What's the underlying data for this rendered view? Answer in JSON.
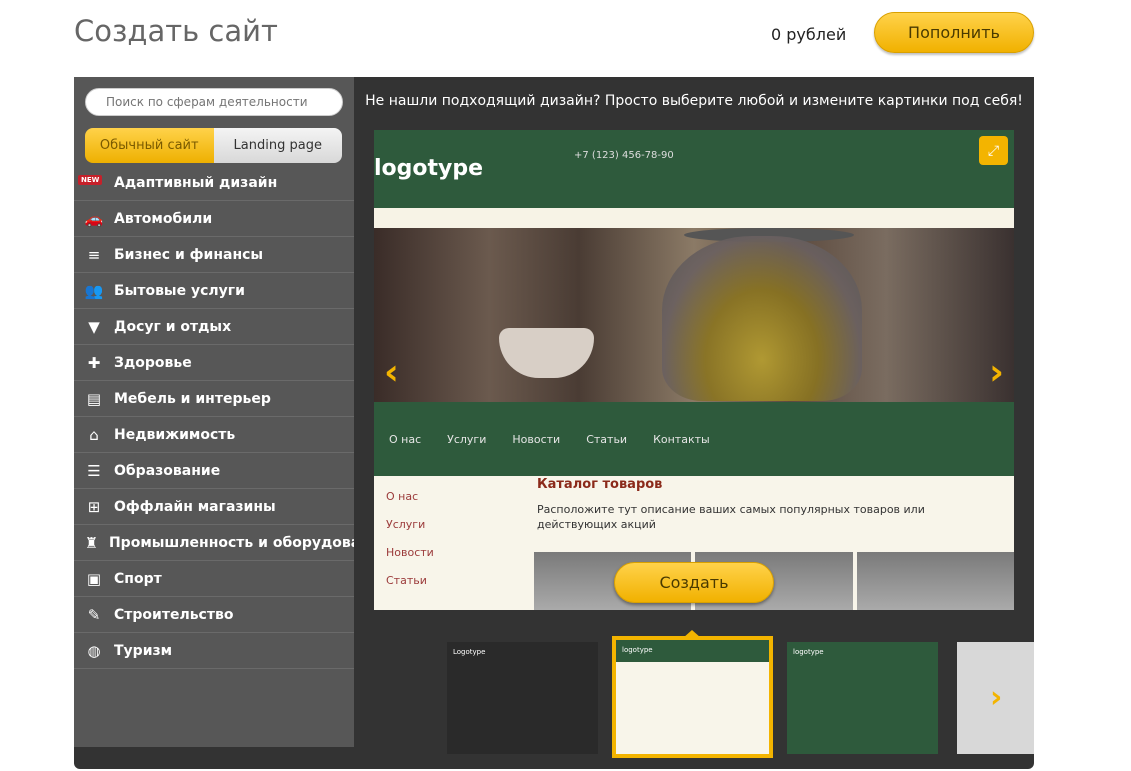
{
  "header": {
    "title": "Создать сайт",
    "balance": "0 рублей",
    "topup_label": "Пополнить"
  },
  "sidebar": {
    "search_placeholder": "Поиск по сферам деятельности",
    "tabs": [
      {
        "label": "Обычный сайт",
        "active": true
      },
      {
        "label": "Landing page",
        "active": false
      }
    ],
    "new_badge": "NEW",
    "items": [
      {
        "label": "Адаптивный дизайн",
        "icon": "new-badge-icon"
      },
      {
        "label": "Автомобили",
        "icon": "car-icon"
      },
      {
        "label": "Бизнес и финансы",
        "icon": "coins-icon"
      },
      {
        "label": "Бытовые услуги",
        "icon": "people-icon"
      },
      {
        "label": "Досуг и отдых",
        "icon": "ice-cream-icon"
      },
      {
        "label": "Здоровье",
        "icon": "cross-icon"
      },
      {
        "label": "Мебель и интерьер",
        "icon": "furniture-icon"
      },
      {
        "label": "Недвижимость",
        "icon": "house-icon"
      },
      {
        "label": "Образование",
        "icon": "books-icon"
      },
      {
        "label": "Оффлайн магазины",
        "icon": "shop-icon"
      },
      {
        "label": "Промышленность и оборудование",
        "icon": "industry-icon"
      },
      {
        "label": "Спорт",
        "icon": "sport-icon"
      },
      {
        "label": "Строительство",
        "icon": "brush-icon"
      },
      {
        "label": "Туризм",
        "icon": "globe-icon"
      }
    ]
  },
  "main": {
    "hint": "Не нашли подходящий дизайн? Просто выберите любой и измените картинки под себя!",
    "create_label": "Создать",
    "preview": {
      "logo": "logotype",
      "phone": "+7 (123) 456-78-90",
      "nav": [
        "О нас",
        "Услуги",
        "Новости",
        "Статьи",
        "Контакты"
      ],
      "side_links": [
        "О нас",
        "Услуги",
        "Новости",
        "Статьи"
      ],
      "catalog_title": "Каталог товаров",
      "catalog_text": "Расположите тут описание ваших самых популярных товаров или действующих акций"
    },
    "thumbnails": [
      {
        "label": "Logotype"
      },
      {
        "label": "logotype"
      },
      {
        "label": "logotype"
      },
      {
        "label": ""
      }
    ]
  },
  "colors": {
    "accent": "#f3b400",
    "sidebar_bg": "#575757",
    "panel_bg": "#333333",
    "preview_green": "#2e5a3c"
  }
}
